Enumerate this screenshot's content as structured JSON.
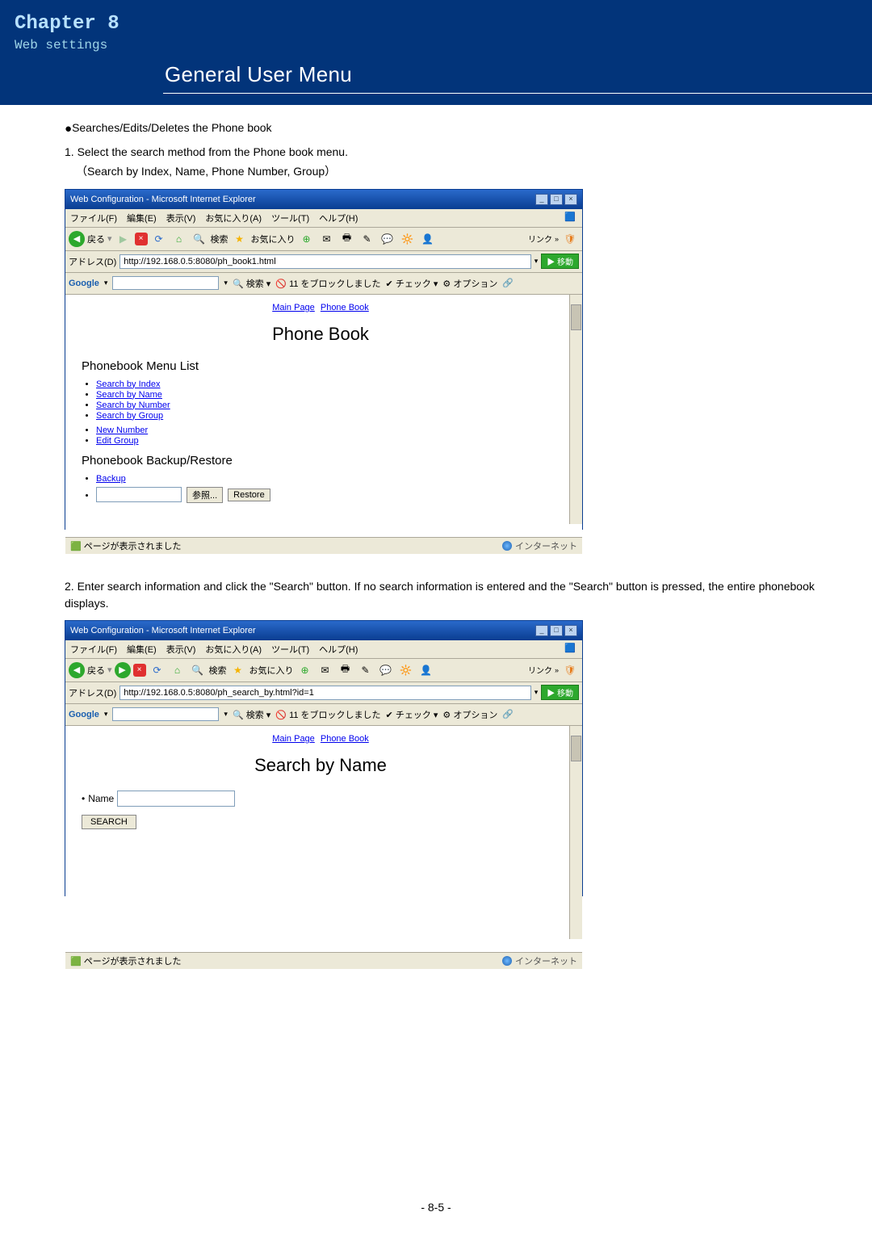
{
  "chapter": {
    "title": "Chapter 8",
    "subtitle": "Web settings"
  },
  "header": {
    "title": "General User Menu"
  },
  "bullet1": "Searches/Edits/Deletes the Phone book",
  "step1": "1. Select the search method from the Phone book menu.",
  "step1_note": "（Search by Index, Name, Phone Number, Group）",
  "ie1": {
    "title": "Web Configuration - Microsoft Internet Explorer",
    "menu": [
      "ファイル(F)",
      "編集(E)",
      "表示(V)",
      "お気に入り(A)",
      "ツール(T)",
      "ヘルプ(H)"
    ],
    "back": "戻る",
    "search_label": "検索",
    "fav_label": "お気に入り",
    "link_label": "リンク",
    "addr_label": "アドレス(D)",
    "url": "http://192.168.0.5:8080/ph_book1.html",
    "go": "移動",
    "google": "Google",
    "gsearch": "検索",
    "gblock": "11 をブロックしました",
    "gcheck": "チェック",
    "gopt": "オプション",
    "links": {
      "main": "Main Page",
      "pb": "Phone Book"
    },
    "h1": "Phone Book",
    "menulist_h": "Phonebook Menu List",
    "items": [
      "Search by Index",
      "Search by Name",
      "Search by Number",
      "Search by Group"
    ],
    "items2": [
      "New Number",
      "Edit Group"
    ],
    "backup_h": "Phonebook Backup/Restore",
    "backup": "Backup",
    "browse": "参照...",
    "restore": "Restore",
    "status": "ページが表示されました",
    "zone": "インターネット"
  },
  "step2": "2. Enter search information and click the \"Search\" button. If no search information is entered and the \"Search\" button is pressed, the entire phonebook displays.",
  "ie2": {
    "title": "Web Configuration - Microsoft Internet Explorer",
    "menu": [
      "ファイル(F)",
      "編集(E)",
      "表示(V)",
      "お気に入り(A)",
      "ツール(T)",
      "ヘルプ(H)"
    ],
    "back": "戻る",
    "search_label": "検索",
    "fav_label": "お気に入り",
    "link_label": "リンク",
    "addr_label": "アドレス(D)",
    "url": "http://192.168.0.5:8080/ph_search_by.html?id=1",
    "go": "移動",
    "google": "Google",
    "gsearch": "検索",
    "gblock": "11 をブロックしました",
    "gcheck": "チェック",
    "gopt": "オプション",
    "links": {
      "main": "Main Page",
      "pb": "Phone Book"
    },
    "h1": "Search by Name",
    "name_label": "Name",
    "search_btn": "SEARCH",
    "status": "ページが表示されました",
    "zone": "インターネット"
  },
  "page_number": "- 8-5 -"
}
